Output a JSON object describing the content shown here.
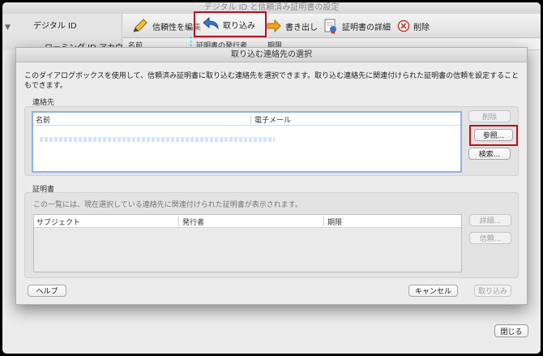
{
  "outer": {
    "title": "デジタル ID と信頼済み証明書の設定",
    "sidebar": [
      {
        "label": "デジタル ID"
      },
      {
        "label": "ローミング ID アカウ"
      }
    ],
    "toolbar": [
      {
        "label": "信頼性を編集",
        "icon": "pencil-icon"
      },
      {
        "label": "取り込み",
        "icon": "import-arrow-icon"
      },
      {
        "label": "書き出し",
        "icon": "export-arrow-icon"
      },
      {
        "label": "証明書の詳細",
        "icon": "certificate-icon"
      },
      {
        "label": "削除",
        "icon": "delete-icon"
      }
    ],
    "columns": [
      "名前",
      "証明書の発行者",
      "期限"
    ],
    "close_label": "閉じる"
  },
  "dialog": {
    "title": "取り込む連絡先の選択",
    "description": "このダイアログボックスを使用して、信頼済み証明書に取り込む連絡先を選択できます。取り込む連絡先に関連付けられた証明書の信頼を設定することもできます。",
    "contacts": {
      "label": "連絡先",
      "columns": [
        "名前",
        "電子メール"
      ],
      "buttons": {
        "delete": "削除",
        "browse": "参照...",
        "search": "検索..."
      }
    },
    "certificates": {
      "label": "証明書",
      "hint": "この一覧には、現在選択している連絡先に関連付けられた証明書が表示されます。",
      "columns": [
        "サブジェクト",
        "発行者",
        "期限"
      ],
      "buttons": {
        "details": "詳細...",
        "trust": "信頼..."
      }
    },
    "footer": {
      "help": "ヘルプ",
      "cancel": "キャンセル",
      "import": "取り込み"
    }
  },
  "colors": {
    "highlight": "#b3141f",
    "focus": "#8fb2e4"
  }
}
